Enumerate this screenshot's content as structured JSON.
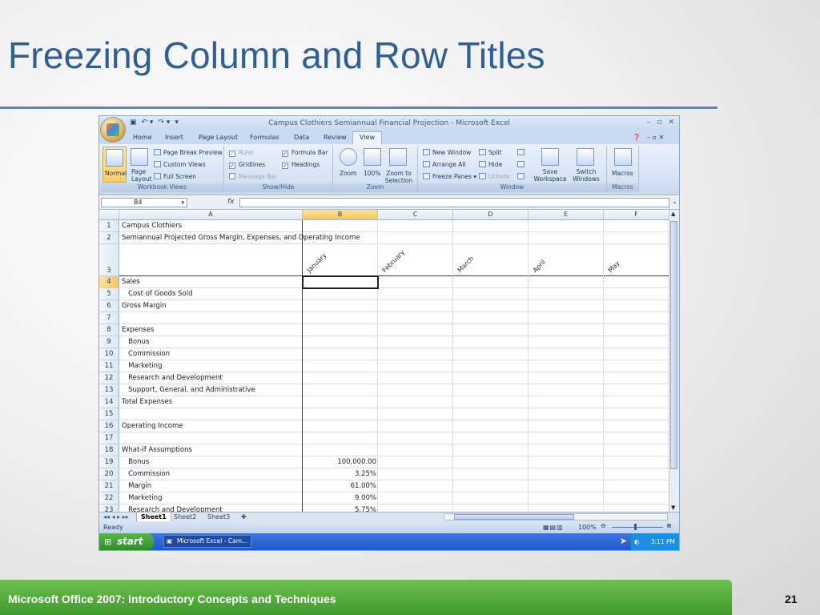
{
  "slide": {
    "title": "Freezing Column and Row Titles",
    "footer": "Microsoft Office 2007: Introductory Concepts and Techniques",
    "page_number": "21"
  },
  "window": {
    "title": "Campus Clothiers Semiannual Financial Projection - Microsoft Excel",
    "controls": [
      "–",
      "▫",
      "✕"
    ]
  },
  "tabs": [
    "Home",
    "Insert",
    "Page Layout",
    "Formulas",
    "Data",
    "Review",
    "View"
  ],
  "active_tab": "View",
  "ribbon": {
    "workbook_views": {
      "label": "Workbook Views",
      "normal": "Normal",
      "page_layout": "Page Layout",
      "page_break_preview": "Page Break Preview",
      "custom_views": "Custom Views",
      "full_screen": "Full Screen"
    },
    "show_hide": {
      "label": "Show/Hide",
      "ruler": "Ruler",
      "gridlines": "Gridlines",
      "message_bar": "Message Bar",
      "formula_bar": "Formula Bar",
      "headings": "Headings"
    },
    "zoom": {
      "label": "Zoom",
      "zoom": "Zoom",
      "hundred": "100%",
      "zoom_to_selection": "Zoom to Selection"
    },
    "window": {
      "label": "Window",
      "new_window": "New Window",
      "arrange_all": "Arrange All",
      "freeze_panes": "Freeze Panes",
      "split": "Split",
      "hide": "Hide",
      "unhide": "Unhide",
      "save_workspace": "Save Workspace",
      "switch_windows": "Switch Windows"
    },
    "macros": {
      "label": "Macros",
      "macros": "Macros"
    }
  },
  "formula_bar": {
    "name_box": "B4",
    "fx": "fx",
    "content": ""
  },
  "columns": [
    "A",
    "B",
    "C",
    "D",
    "E",
    "F"
  ],
  "months": [
    "January",
    "February",
    "March",
    "April",
    "May"
  ],
  "rows": [
    {
      "n": "1",
      "a": "Campus Clothiers",
      "b": ""
    },
    {
      "n": "2",
      "a": "Semiannual Projected Gross Margin, Expenses, and Operating Income",
      "b": ""
    },
    {
      "n": "3",
      "a": "",
      "b": ""
    },
    {
      "n": "4",
      "a": "Sales",
      "b": ""
    },
    {
      "n": "5",
      "a": "   Cost of Goods Sold",
      "b": ""
    },
    {
      "n": "6",
      "a": "Gross Margin",
      "b": ""
    },
    {
      "n": "7",
      "a": "",
      "b": ""
    },
    {
      "n": "8",
      "a": "Expenses",
      "b": ""
    },
    {
      "n": "9",
      "a": "   Bonus",
      "b": ""
    },
    {
      "n": "10",
      "a": "   Commission",
      "b": ""
    },
    {
      "n": "11",
      "a": "   Marketing",
      "b": ""
    },
    {
      "n": "12",
      "a": "   Research and Development",
      "b": ""
    },
    {
      "n": "13",
      "a": "   Support, General, and Administrative",
      "b": ""
    },
    {
      "n": "14",
      "a": "Total Expenses",
      "b": ""
    },
    {
      "n": "15",
      "a": "",
      "b": ""
    },
    {
      "n": "16",
      "a": "Operating Income",
      "b": ""
    },
    {
      "n": "17",
      "a": "",
      "b": ""
    },
    {
      "n": "18",
      "a": "What-if Assumptions",
      "b": ""
    },
    {
      "n": "19",
      "a": "   Bonus",
      "b": "100,000.00"
    },
    {
      "n": "20",
      "a": "   Commission",
      "b": "3.25%"
    },
    {
      "n": "21",
      "a": "   Margin",
      "b": "61.00%"
    },
    {
      "n": "22",
      "a": "   Marketing",
      "b": "9.00%"
    },
    {
      "n": "23",
      "a": "   Research and Development",
      "b": "5.75%"
    }
  ],
  "sheet_tabs": [
    "Sheet1",
    "Sheet2",
    "Sheet3"
  ],
  "status": {
    "ready": "Ready",
    "zoom": "100%"
  },
  "taskbar": {
    "start": "start",
    "item": "Microsoft Excel - Cam...",
    "clock": "3:11 PM"
  }
}
